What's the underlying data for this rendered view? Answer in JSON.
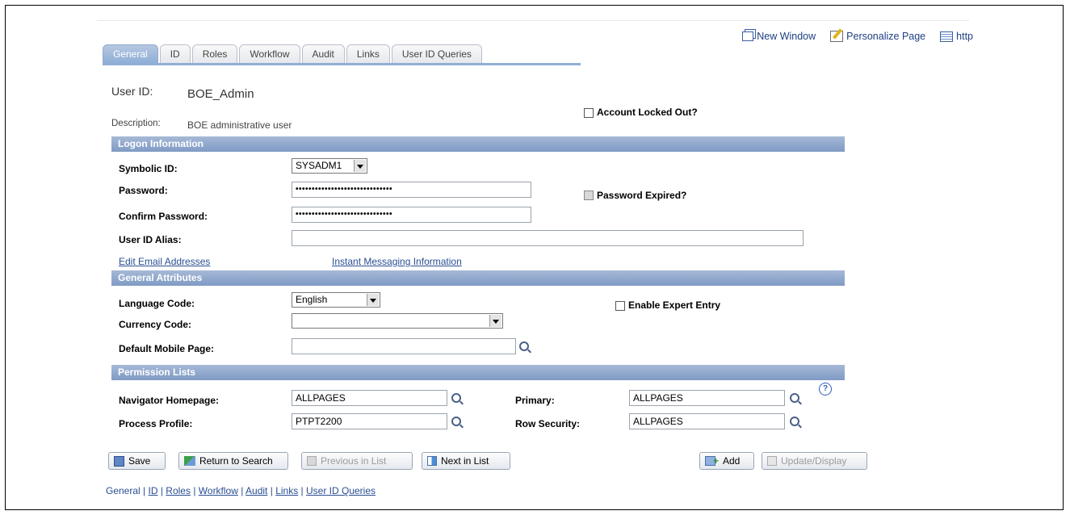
{
  "top_links": {
    "new_window": "New Window",
    "personalize_page": "Personalize Page",
    "http": "http"
  },
  "tabs": [
    {
      "label": "General",
      "active": true
    },
    {
      "label": "ID"
    },
    {
      "label": "Roles"
    },
    {
      "label": "Workflow"
    },
    {
      "label": "Audit"
    },
    {
      "label": "Links"
    },
    {
      "label": "User ID Queries"
    }
  ],
  "header": {
    "user_id_label": "User ID:",
    "user_id_value": "BOE_Admin",
    "description_label": "Description:",
    "description_value": "BOE administrative user",
    "account_locked_label": "Account Locked Out?"
  },
  "logon": {
    "section_title": "Logon Information",
    "symbolic_id_label": "Symbolic ID:",
    "symbolic_id_value": "SYSADM1",
    "password_label": "Password:",
    "password_value": "••••••••••••••••••••••••••••••",
    "confirm_label": "Confirm Password:",
    "confirm_value": "••••••••••••••••••••••••••••••",
    "password_expired_label": "Password Expired?",
    "alias_label": "User ID Alias:",
    "alias_value": "",
    "edit_email_link": "Edit Email Addresses",
    "instant_messaging_link": "Instant Messaging Information"
  },
  "general_attributes": {
    "section_title": "General Attributes",
    "language_label": "Language Code:",
    "language_value": "English",
    "expert_entry_label": "Enable Expert Entry",
    "currency_label": "Currency Code:",
    "currency_value": "",
    "mobile_label": "Default Mobile Page:",
    "mobile_value": ""
  },
  "permission_lists": {
    "section_title": "Permission Lists",
    "navigator_label": "Navigator Homepage:",
    "navigator_value": "ALLPAGES",
    "primary_label": "Primary:",
    "primary_value": "ALLPAGES",
    "process_label": "Process Profile:",
    "process_value": "PTPT2200",
    "row_security_label": "Row Security:",
    "row_security_value": "ALLPAGES",
    "help_glyph": "?"
  },
  "buttons": {
    "save": "Save",
    "return_to_search": "Return to Search",
    "previous_in_list": "Previous in List",
    "next_in_list": "Next in List",
    "add": "Add",
    "update_display": "Update/Display"
  },
  "footer": {
    "links": [
      "General",
      "ID",
      "Roles",
      "Workflow",
      "Audit",
      "Links",
      "User ID Queries"
    ],
    "separator": " | "
  }
}
